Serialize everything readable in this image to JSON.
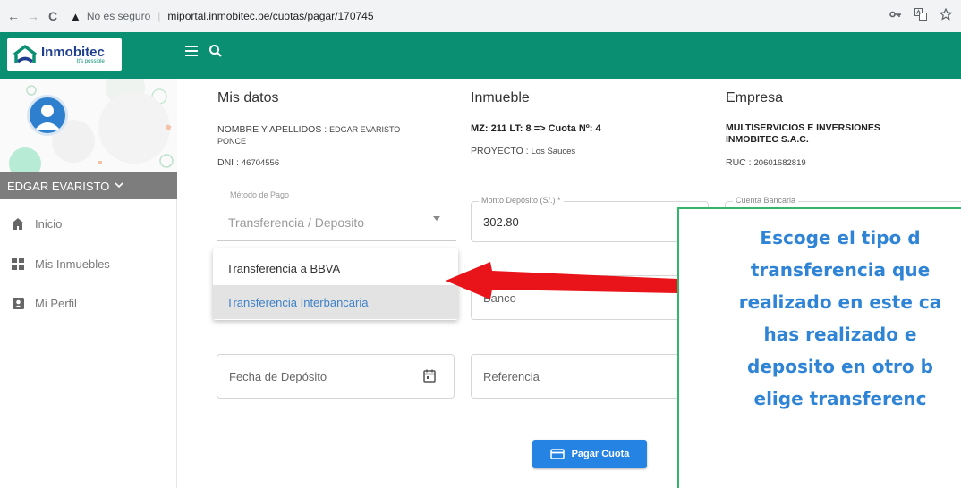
{
  "browser": {
    "back": "←",
    "forward": "→",
    "reload": "C",
    "warning_icon": "▲",
    "not_secure": "No es seguro",
    "separator": "|",
    "url": "miportal.inmobitec.pe/cuotas/pagar/170745",
    "icons": [
      "key-icon",
      "translate-icon",
      "star-icon"
    ]
  },
  "header": {
    "logo_name": "Inmobitec",
    "logo_tag": "It's possible",
    "bg_color": "#0b8f73"
  },
  "sidebar": {
    "user_name": "EDGAR EVARISTO",
    "items": [
      {
        "label": "Inicio",
        "icon": "home-icon"
      },
      {
        "label": "Mis Inmuebles",
        "icon": "grid-icon"
      },
      {
        "label": "Mi Perfil",
        "icon": "profile-icon"
      }
    ]
  },
  "mis_datos": {
    "title": "Mis datos",
    "name_label": "NOMBRE Y APELLIDOS :",
    "name_value_1": "EDGAR EVARISTO",
    "name_value_2": "PONCE",
    "dni_label": "DNI :",
    "dni_value": "46704556"
  },
  "inmueble": {
    "title": "Inmueble",
    "lote": "MZ: 211 LT: 8 => Cuota Nº: 4",
    "proyecto_label": "PROYECTO :",
    "proyecto_value": "Los Sauces"
  },
  "empresa": {
    "title": "Empresa",
    "name_1": "MULTISERVICIOS E INVERSIONES",
    "name_2": "INMOBITEC S.A.C.",
    "ruc_label": "RUC :",
    "ruc_value": "20601682819"
  },
  "form": {
    "metodo_label": "Método de Pago",
    "metodo_value": "Transferencia / Deposito",
    "monto_label": "Monto Depósito (S/.) *",
    "monto_value": "302.80",
    "cuenta_label": "Cuenta Bancaria",
    "banco_placeholder": "Banco",
    "fecha_placeholder": "Fecha de Depósito",
    "referencia_placeholder": "Referencia",
    "options": [
      "Transferencia a BBVA",
      "Transferencia Interbancaria"
    ],
    "selected_option": "Transferencia Interbancaria",
    "pay_button": "Pagar Cuota",
    "accent_color": "#2583e3"
  },
  "annotation": {
    "lines": [
      "Escoge el tipo d",
      "transferencia que",
      "realizado en este ca",
      "has realizado e",
      "deposito en otro b",
      "elige transferenc"
    ],
    "text_color": "#2f84d6",
    "arrow_color": "#e8141a",
    "border_color": "#33b56a"
  }
}
